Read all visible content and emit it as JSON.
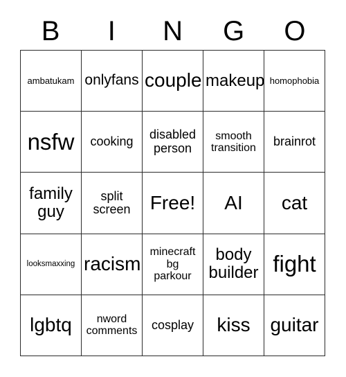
{
  "card": {
    "title_letters": [
      "B",
      "I",
      "N",
      "G",
      "O"
    ],
    "free_space_label": "Free!",
    "colors": {
      "background": "#ffffff",
      "border": "#2b2b2b",
      "text": "#000000"
    },
    "rows": [
      [
        {
          "label": "ambatukam",
          "size": "sz-s"
        },
        {
          "label": "onlyfans",
          "size": "sz-l"
        },
        {
          "label": "couple",
          "size": "sz-xxl"
        },
        {
          "label": "makeup",
          "size": "sz-xl"
        },
        {
          "label": "homophobia",
          "size": "sz-s"
        }
      ],
      [
        {
          "label": "nsfw",
          "size": "sz-huge"
        },
        {
          "label": "cooking",
          "size": "sz-ml"
        },
        {
          "label": "disabled\nperson",
          "size": "sz-ml"
        },
        {
          "label": "smooth\ntransition",
          "size": "sz-m"
        },
        {
          "label": "brainrot",
          "size": "sz-ml"
        }
      ],
      [
        {
          "label": "family\nguy",
          "size": "sz-xl"
        },
        {
          "label": "split\nscreen",
          "size": "sz-ml"
        },
        {
          "label": "Free!",
          "size": "sz-xxl"
        },
        {
          "label": "AI",
          "size": "sz-xxl"
        },
        {
          "label": "cat",
          "size": "sz-xxl"
        }
      ],
      [
        {
          "label": "looksmaxxing",
          "size": "sz-xs"
        },
        {
          "label": "racism",
          "size": "sz-xxl"
        },
        {
          "label": "minecraft\nbg\nparkour",
          "size": "sz-m"
        },
        {
          "label": "body\nbuilder",
          "size": "sz-xl"
        },
        {
          "label": "fight",
          "size": "sz-huge"
        }
      ],
      [
        {
          "label": "lgbtq",
          "size": "sz-xxl"
        },
        {
          "label": "nword\ncomments",
          "size": "sz-m"
        },
        {
          "label": "cosplay",
          "size": "sz-ml"
        },
        {
          "label": "kiss",
          "size": "sz-xxl"
        },
        {
          "label": "guitar",
          "size": "sz-xxl"
        }
      ]
    ]
  }
}
